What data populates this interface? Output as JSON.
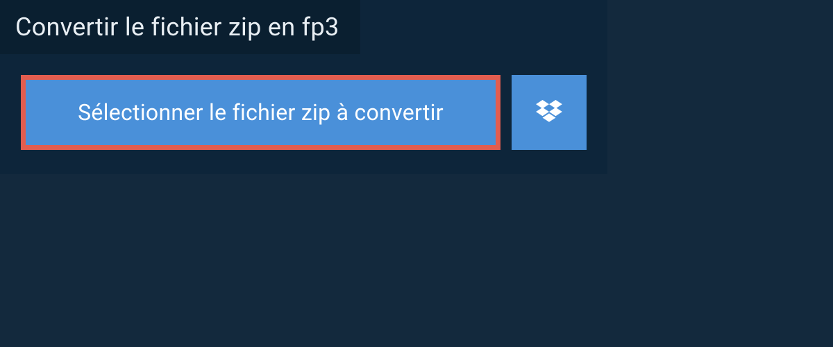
{
  "header": {
    "title": "Convertir le fichier zip en fp3"
  },
  "actions": {
    "select_label": "Sélectionner le fichier zip à convertir"
  }
}
